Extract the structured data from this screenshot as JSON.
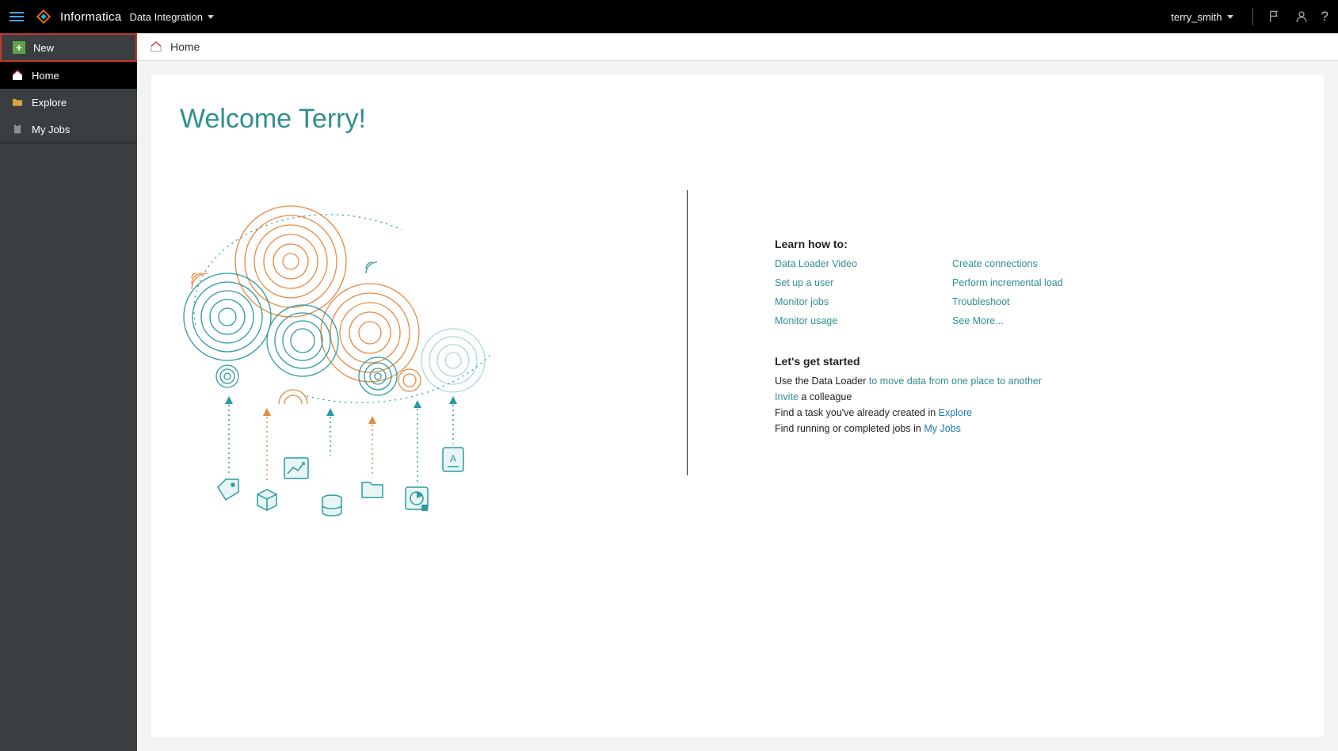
{
  "header": {
    "brand": "Informatica",
    "service": "Data Integration",
    "user": "terry_smith"
  },
  "sidebar": {
    "new_label": "New",
    "items": [
      {
        "id": "home",
        "label": "Home"
      },
      {
        "id": "explore",
        "label": "Explore"
      },
      {
        "id": "myjobs",
        "label": "My Jobs"
      }
    ]
  },
  "breadcrumb": {
    "current": "Home"
  },
  "welcome": "Welcome Terry!",
  "learn": {
    "title": "Learn how to:",
    "col1": [
      "Data Loader Video",
      "Set up a user",
      "Monitor jobs",
      "Monitor usage"
    ],
    "col2": [
      "Create connections",
      "Perform incremental load",
      "Troubleshoot",
      "See More..."
    ]
  },
  "started": {
    "title": "Let's get started",
    "line1_pre": "Use the Data Loader ",
    "line1_link": "to move data from one place to another",
    "line2_link": "Invite",
    "line2_post": " a colleague",
    "line3_pre": "Find a task you've already created in ",
    "line3_link": "Explore",
    "line4_pre": "Find running or completed jobs in ",
    "line4_link": "My Jobs"
  }
}
